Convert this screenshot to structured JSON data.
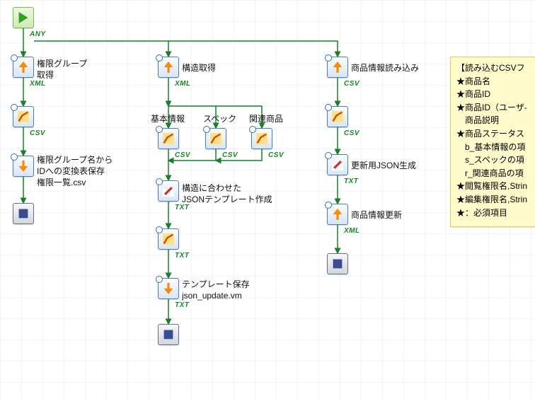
{
  "start_tag": "ANY",
  "col1": {
    "rest_label": "権限グループ\n取得",
    "rest_tag": "XML",
    "map_tag": "CSV",
    "save_label": "権限グループ名から\nIDへの変換表保存\n権限一覧.csv"
  },
  "col2": {
    "rest_label": "構造取得",
    "rest_tag": "XML",
    "branch_labels": {
      "left": "基本情報",
      "mid": "スペック",
      "right": "関連商品"
    },
    "branch_tag": "CSV",
    "json_label": "構造に合わせた\nJSONテンプレート作成",
    "json_tag": "TXT",
    "save_label": "テンプレート保存\njson_update.vm",
    "save_tag": "TXT"
  },
  "col3": {
    "load_label": "商品情報読み込み",
    "load_tag": "CSV",
    "map_tag": "CSV",
    "gen_label": "更新用JSON生成",
    "gen_tag": "TXT",
    "update_label": "商品情報更新",
    "update_tag": "XML"
  },
  "note": {
    "title": "【読み込むCSVフ",
    "lines": [
      "★商品名",
      "★商品ID",
      "★商品ID（ユーザ-",
      "　商品説明",
      "★商品ステータス",
      "　b_基本情報の項",
      "　s_スペックの項",
      "　r_関連商品の項",
      "★閲覧権限名,Strin",
      "★編集権限名,Strin",
      "",
      "★：必須項目"
    ]
  }
}
